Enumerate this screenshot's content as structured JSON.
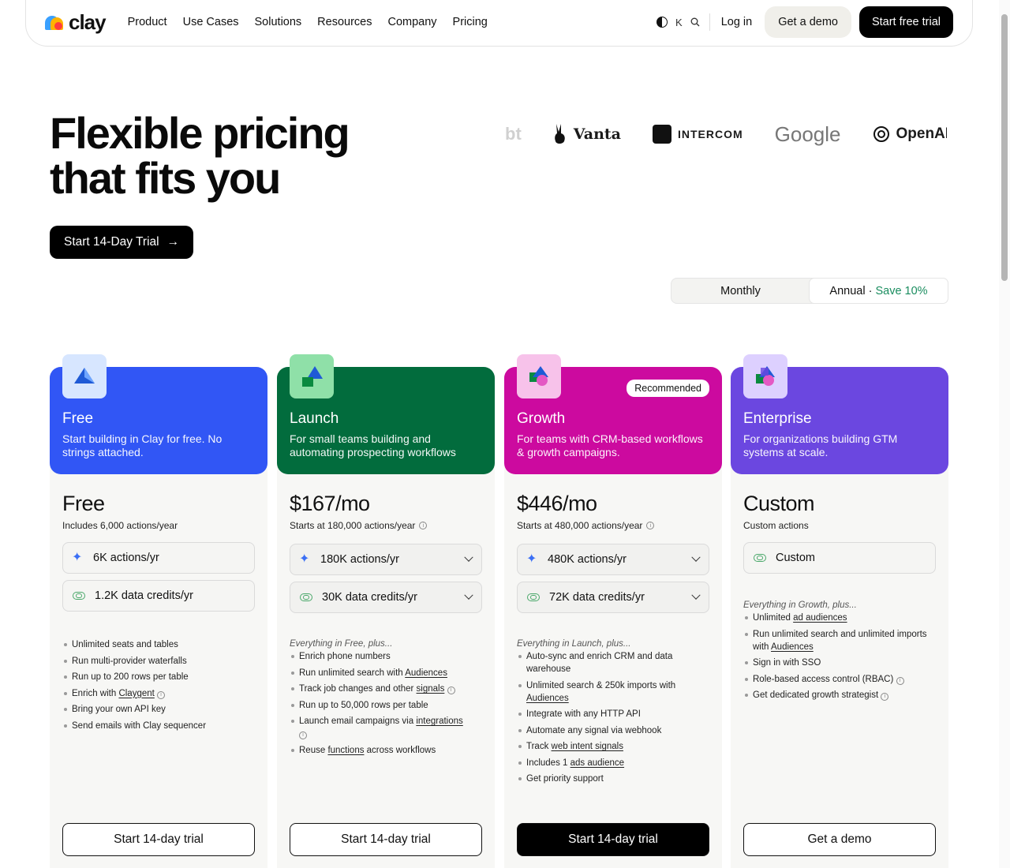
{
  "nav": {
    "logo_text": "clay",
    "links": [
      "Product",
      "Use Cases",
      "Solutions",
      "Resources",
      "Company",
      "Pricing"
    ],
    "shortcut_key": "K",
    "login": "Log in",
    "demo": "Get a demo",
    "trial": "Start free trial"
  },
  "hero": {
    "title_line1": "Flexible pricing",
    "title_line2": "that fits you",
    "cta": "Start 14-Day Trial",
    "cta_arrow": "→",
    "logos": [
      "bt",
      "Vanta",
      "INTERCOM",
      "Google",
      "OpenAI"
    ]
  },
  "billing": {
    "monthly": "Monthly",
    "annual": "Annual",
    "annual_sep": "·",
    "save": "Save 10%"
  },
  "plans": [
    {
      "name": "Free",
      "desc": "Start building in Clay for free. No strings attached.",
      "color": "#3156f5",
      "icon_bg": "#d7e6ff",
      "price": "Free",
      "price_sub": "Includes 6,000 actions/year",
      "actions": "6K actions/yr",
      "credits": "1.2K data credits/yr",
      "plus": "",
      "features": [
        "Unlimited seats and tables",
        "Run multi-provider waterfalls",
        "Run up to 200 rows per table",
        "Enrich with Claygent",
        "Bring your own API key",
        "Send emails with Clay sequencer"
      ],
      "cta": "Start 14-day trial"
    },
    {
      "name": "Launch",
      "desc": "For small teams building and automating prospecting workflows",
      "color": "#026c3d",
      "icon_bg": "#8fe0a8",
      "price": "$167/mo",
      "price_sub": "Starts at 180,000 actions/year",
      "actions": "180K actions/yr",
      "credits": "30K data credits/yr",
      "plus": "Everything in Free, plus...",
      "features": [
        "Enrich phone numbers",
        "Run unlimited search with Audiences",
        "Track job changes and other signals",
        "Run up to 50,000 rows per table",
        "Launch email campaigns via integrations",
        "Reuse functions across workflows"
      ],
      "cta": "Start 14-day trial"
    },
    {
      "name": "Growth",
      "desc": "For teams with CRM-based workflows & growth campaigns.",
      "color": "#cc0a9f",
      "icon_bg": "#f7c2ea",
      "badge": "Recommended",
      "price": "$446/mo",
      "price_sub": "Starts at 480,000 actions/year",
      "actions": "480K actions/yr",
      "credits": "72K data credits/yr",
      "plus": "Everything in Launch, plus...",
      "features": [
        "Auto-sync and enrich CRM and data warehouse",
        "Unlimited search & 250k imports with Audiences",
        "Integrate with any HTTP API",
        "Automate any signal via webhook",
        "Track web intent signals",
        "Includes 1 ads audience",
        "Get priority support"
      ],
      "cta": "Start 14-day trial"
    },
    {
      "name": "Enterprise",
      "desc": "For organizations building GTM systems at scale.",
      "color": "#6b47e0",
      "icon_bg": "#ddd0ff",
      "price": "Custom",
      "price_sub": "Custom actions",
      "credits": "Custom",
      "plus": "Everything in Growth, plus...",
      "features": [
        "Unlimited ad audiences",
        "Run unlimited search and unlimited imports with Audiences",
        "Sign in with SSO",
        "Role-based access control (RBAC)",
        "Get dedicated growth strategist"
      ],
      "cta": "Get a demo"
    }
  ]
}
